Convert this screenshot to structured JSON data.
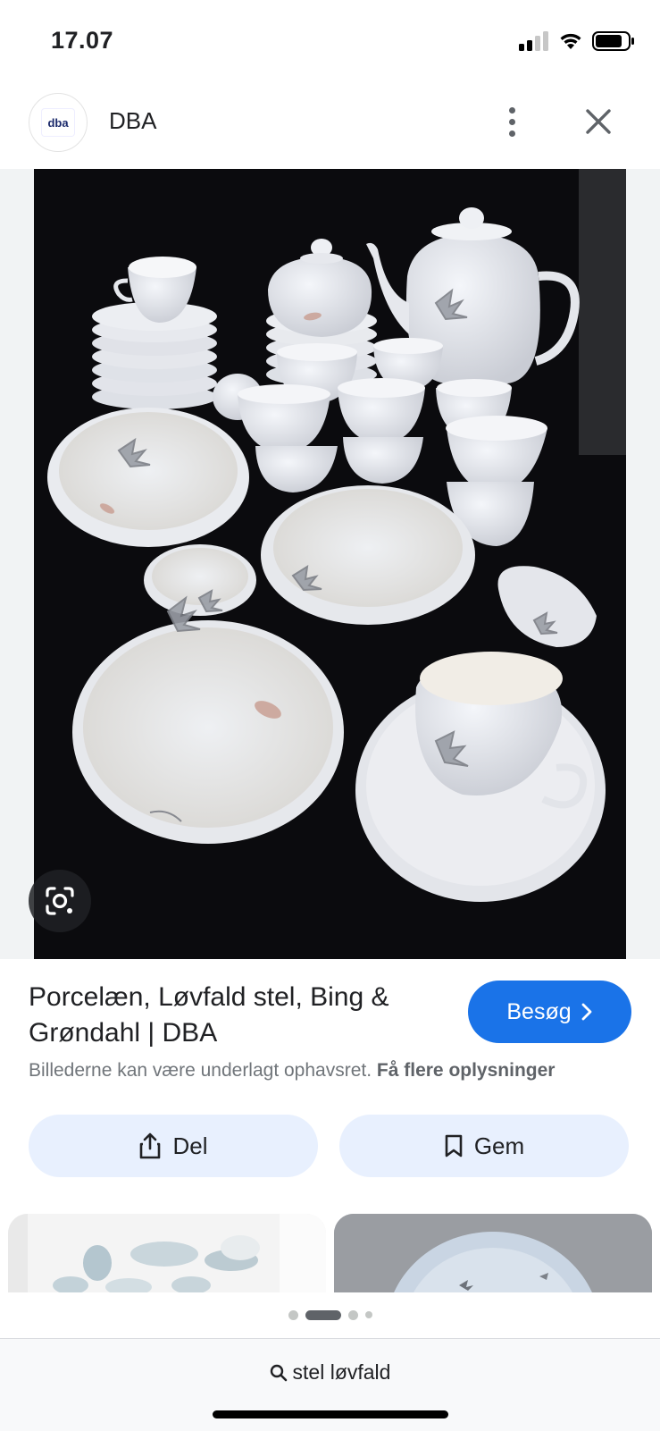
{
  "status_bar": {
    "time": "17.07"
  },
  "header": {
    "logo_text": "dba",
    "site_name": "DBA"
  },
  "result": {
    "title": "Porcelæn, Løvfald stel, Bing & Grøndahl | DBA",
    "visit_label": "Besøg",
    "copyright_text": "Billederne kan være underlagt ophavsret.",
    "more_info_label": "Få flere oplysninger"
  },
  "actions": {
    "share_label": "Del",
    "save_label": "Gem"
  },
  "bottom": {
    "search_query": "stel løvfald"
  },
  "icons": {
    "signal": "signal-icon",
    "wifi": "wifi-icon",
    "battery": "battery-icon",
    "menu": "more-vert-icon",
    "close": "close-icon",
    "lens": "google-lens-icon",
    "share": "share-icon",
    "bookmark": "bookmark-icon",
    "search": "search-icon",
    "chevron": "chevron-right-icon"
  },
  "colors": {
    "accent": "#1a73e8",
    "chip_bg": "#e8f0fe",
    "photo_bg": "#0b0b0e"
  }
}
